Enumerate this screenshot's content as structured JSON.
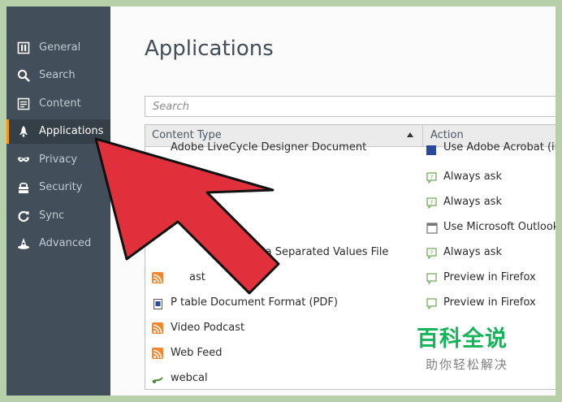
{
  "sidebar": {
    "items": [
      {
        "label": "General",
        "icon": "general-icon"
      },
      {
        "label": "Search",
        "icon": "search-icon"
      },
      {
        "label": "Content",
        "icon": "content-icon"
      },
      {
        "label": "Applications",
        "icon": "rocket-icon",
        "active": true
      },
      {
        "label": "Privacy",
        "icon": "mask-icon"
      },
      {
        "label": "Security",
        "icon": "lock-icon"
      },
      {
        "label": "Sync",
        "icon": "sync-icon"
      },
      {
        "label": "Advanced",
        "icon": "wizard-hat-icon"
      }
    ],
    "accent_color": "#ff9500"
  },
  "main": {
    "title": "Applications",
    "search": {
      "placeholder": "Search"
    },
    "table": {
      "columns": [
        "Content Type",
        "Action"
      ],
      "rows": [
        {
          "content_type": "Adobe LiveCycle Designer Document",
          "action": "Use Adobe Acrobat (in F"
        },
        {
          "content_type": "",
          "action": "Always ask"
        },
        {
          "content_type": "",
          "action": "Always ask"
        },
        {
          "content_type": "",
          "action": "Use Microsoft Outlook ("
        },
        {
          "content_type": "ma Separated Values File",
          "action": "Always ask"
        },
        {
          "content_type": "ast",
          "action": "Preview in Firefox"
        },
        {
          "content_type": "P  table Document Format (PDF)",
          "action": "Preview in Firefox"
        },
        {
          "content_type": "Video Podcast",
          "action": ""
        },
        {
          "content_type": "Web Feed",
          "action": ""
        },
        {
          "content_type": "webcal",
          "action": ""
        }
      ]
    }
  },
  "watermark": {
    "title": "百科全说",
    "subtitle": "助你轻松解决"
  },
  "colors": {
    "arrow_fill": "#e0303c",
    "sidebar_bg": "#424f5a",
    "watermark_green": "#16b45a"
  }
}
